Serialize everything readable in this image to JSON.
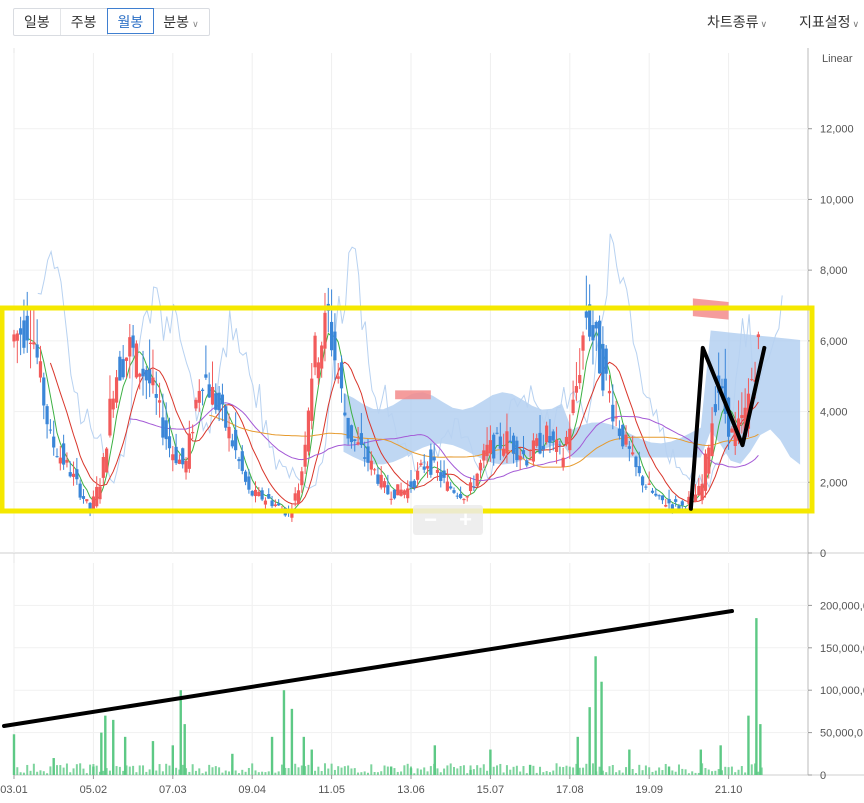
{
  "toolbar": {
    "tabs": [
      "일봉",
      "주봉",
      "월봉",
      "분봉"
    ],
    "active_tab": "월봉",
    "chart_type_menu": "차트종류",
    "indicator_menu": "지표설정"
  },
  "zoom": {
    "minus": "−",
    "plus": "+"
  },
  "colors": {
    "rising": "#f25b5b",
    "falling": "#3a86d8",
    "volume": "#5dc985",
    "highlight_box": "#f5e800",
    "annotation": "#000000",
    "cloud_blue": "#a9c9ef",
    "cloud_red": "#f38b8b"
  },
  "chart_data": [
    {
      "type": "candlestick",
      "scale_label": "Linear",
      "ylim": [
        0,
        14000
      ],
      "y_ticks": [
        "0",
        "2,000",
        "4,000",
        "6,000",
        "8,000",
        "10,000",
        "12,000"
      ],
      "x_ticks": [
        "03.01",
        "05.02",
        "07.03",
        "09.04",
        "11.05",
        "13.06",
        "15.07",
        "17.08",
        "19.09",
        "21.10"
      ],
      "price_path": [
        [
          2003.0,
          6000
        ],
        [
          2003.5,
          6600
        ],
        [
          2004.0,
          3200
        ],
        [
          2004.5,
          2300
        ],
        [
          2005.0,
          1200
        ],
        [
          2005.3,
          2200
        ],
        [
          2005.6,
          5000
        ],
        [
          2006.0,
          5800
        ],
        [
          2006.5,
          4800
        ],
        [
          2007.0,
          3000
        ],
        [
          2007.4,
          2400
        ],
        [
          2007.8,
          5200
        ],
        [
          2008.5,
          3400
        ],
        [
          2009.0,
          1700
        ],
        [
          2009.5,
          1500
        ],
        [
          2010.0,
          1100
        ],
        [
          2010.3,
          2000
        ],
        [
          2010.6,
          5400
        ],
        [
          2011.0,
          6600
        ],
        [
          2011.5,
          3400
        ],
        [
          2012.0,
          2600
        ],
        [
          2012.5,
          1700
        ],
        [
          2013.0,
          1800
        ],
        [
          2013.5,
          2600
        ],
        [
          2014.0,
          1900
        ],
        [
          2014.5,
          1600
        ],
        [
          2015.0,
          2900
        ],
        [
          2015.5,
          3200
        ],
        [
          2016.0,
          2700
        ],
        [
          2016.5,
          3300
        ],
        [
          2016.9,
          2700
        ],
        [
          2017.2,
          4300
        ],
        [
          2017.5,
          6800
        ],
        [
          2017.9,
          5200
        ],
        [
          2018.3,
          3600
        ],
        [
          2018.8,
          2200
        ],
        [
          2019.3,
          1500
        ],
        [
          2019.9,
          1300
        ],
        [
          2020.4,
          1800
        ],
        [
          2020.8,
          4800
        ],
        [
          2021.2,
          3200
        ],
        [
          2021.5,
          3900
        ],
        [
          2021.8,
          5800
        ]
      ]
    },
    {
      "type": "bar",
      "series_name": "volume",
      "ylim": [
        0,
        250000000
      ],
      "y_ticks": [
        "0",
        "50,000,0",
        "100,000,0",
        "150,000,0",
        "200,000,0"
      ],
      "values": [
        [
          2003.0,
          48000000
        ],
        [
          2004.0,
          20000000
        ],
        [
          2005.0,
          10000000
        ],
        [
          2005.2,
          50000000
        ],
        [
          2005.3,
          70000000
        ],
        [
          2005.5,
          65000000
        ],
        [
          2005.8,
          45000000
        ],
        [
          2006.5,
          40000000
        ],
        [
          2007.0,
          35000000
        ],
        [
          2007.2,
          100000000
        ],
        [
          2007.3,
          60000000
        ],
        [
          2008.5,
          25000000
        ],
        [
          2009.5,
          45000000
        ],
        [
          2009.8,
          100000000
        ],
        [
          2010.0,
          78000000
        ],
        [
          2010.3,
          45000000
        ],
        [
          2010.5,
          30000000
        ],
        [
          2012.5,
          10000000
        ],
        [
          2013.0,
          8000000
        ],
        [
          2013.6,
          35000000
        ],
        [
          2014.5,
          6000000
        ],
        [
          2015.0,
          30000000
        ],
        [
          2016.0,
          12000000
        ],
        [
          2017.2,
          45000000
        ],
        [
          2017.5,
          80000000
        ],
        [
          2017.65,
          140000000
        ],
        [
          2017.8,
          110000000
        ],
        [
          2018.5,
          30000000
        ],
        [
          2019.5,
          10000000
        ],
        [
          2020.3,
          30000000
        ],
        [
          2020.8,
          35000000
        ],
        [
          2021.5,
          70000000
        ],
        [
          2021.7,
          185000000
        ],
        [
          2021.8,
          60000000
        ]
      ]
    }
  ]
}
